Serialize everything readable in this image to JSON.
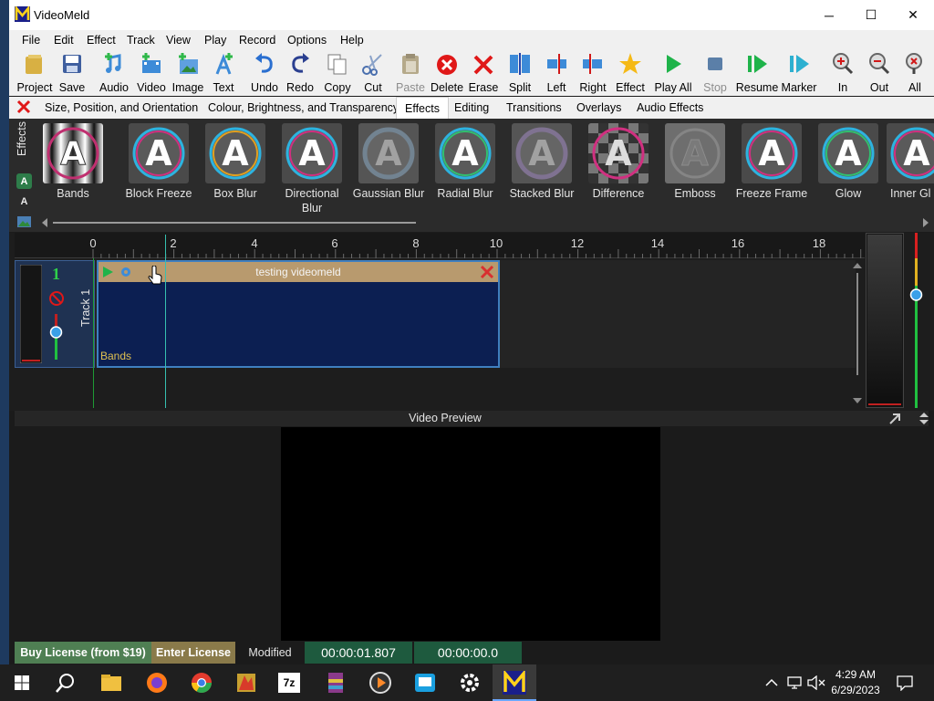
{
  "window": {
    "title": "VideoMeld",
    "minimize_glyph": "─",
    "maximize_glyph": "☐",
    "close_glyph": "✕"
  },
  "menu": [
    "File",
    "Edit",
    "Effect",
    "Track",
    "View",
    "Play",
    "Record",
    "Options",
    "Help"
  ],
  "toolbar": [
    {
      "label": "Project",
      "icon": "folder-icon",
      "enabled": true
    },
    {
      "label": "Save",
      "icon": "save-icon",
      "enabled": true
    },
    {
      "label": "Audio",
      "icon": "add-audio-icon",
      "enabled": true
    },
    {
      "label": "Video",
      "icon": "add-video-icon",
      "enabled": true
    },
    {
      "label": "Image",
      "icon": "add-image-icon",
      "enabled": true
    },
    {
      "label": "Text",
      "icon": "add-text-icon",
      "enabled": true
    },
    {
      "label": "Undo",
      "icon": "undo-icon",
      "enabled": true
    },
    {
      "label": "Redo",
      "icon": "redo-icon",
      "enabled": true
    },
    {
      "label": "Copy",
      "icon": "copy-icon",
      "enabled": true
    },
    {
      "label": "Cut",
      "icon": "scissors-icon",
      "enabled": true
    },
    {
      "label": "Paste",
      "icon": "paste-icon",
      "enabled": false
    },
    {
      "label": "Delete",
      "icon": "delete-icon",
      "enabled": true
    },
    {
      "label": "Erase",
      "icon": "erase-icon",
      "enabled": true
    },
    {
      "label": "Split",
      "icon": "split-icon",
      "enabled": true
    },
    {
      "label": "Left",
      "icon": "trim-left-icon",
      "enabled": true
    },
    {
      "label": "Right",
      "icon": "trim-right-icon",
      "enabled": true
    },
    {
      "label": "Effect",
      "icon": "star-icon",
      "enabled": true
    },
    {
      "label": "Play All",
      "icon": "play-icon",
      "enabled": true
    },
    {
      "label": "Stop",
      "icon": "stop-icon",
      "enabled": false
    },
    {
      "label": "Resume",
      "icon": "resume-icon",
      "enabled": true
    },
    {
      "label": "Marker",
      "icon": "marker-icon",
      "enabled": true
    },
    {
      "label": "In",
      "icon": "zoom-in-icon",
      "enabled": true
    },
    {
      "label": "Out",
      "icon": "zoom-out-icon",
      "enabled": true
    },
    {
      "label": "All",
      "icon": "zoom-all-icon",
      "enabled": true
    }
  ],
  "tabs": [
    {
      "label": "Size, Position, and Orientation",
      "active": false
    },
    {
      "label": "Colour, Brightness, and Transparency",
      "active": false
    },
    {
      "label": "Effects",
      "active": true
    },
    {
      "label": "Editing",
      "active": false
    },
    {
      "label": "Transitions",
      "active": false
    },
    {
      "label": "Overlays",
      "active": false
    },
    {
      "label": "Audio Effects",
      "active": false
    }
  ],
  "effects_panel": {
    "side_label": "Effects",
    "side_letter_a": "A",
    "side_letter_a2": "A",
    "items": [
      {
        "name": "Bands",
        "style": "bands"
      },
      {
        "name": "Block Freeze",
        "style": "ring"
      },
      {
        "name": "Box Blur",
        "style": "ring"
      },
      {
        "name": "Directional Blur",
        "style": "ring"
      },
      {
        "name": "Gaussian Blur",
        "style": "blur"
      },
      {
        "name": "Radial Blur",
        "style": "ring"
      },
      {
        "name": "Stacked Blur",
        "style": "blur"
      },
      {
        "name": "Difference",
        "style": "checker"
      },
      {
        "name": "Emboss",
        "style": "emboss"
      },
      {
        "name": "Freeze Frame",
        "style": "ring"
      },
      {
        "name": "Glow",
        "style": "ring"
      },
      {
        "name": "Inner Gl",
        "style": "ring"
      }
    ]
  },
  "timeline": {
    "ruler_labels": [
      "0",
      "2",
      "4",
      "6",
      "8",
      "10",
      "12",
      "14",
      "16",
      "18"
    ],
    "track": {
      "number": "1",
      "name": "Track 1"
    },
    "clip": {
      "title": "testing videomeld",
      "effect_label": "Bands"
    }
  },
  "preview": {
    "title": "Video Preview"
  },
  "status": {
    "buy_license": "Buy License (from $19)",
    "enter_license": "Enter License",
    "modified": "Modified",
    "position_time": "00:00:01.807",
    "selection_time": "00:00:00.0"
  },
  "taskbar": {
    "time": "4:29 AM",
    "date": "6/29/2023",
    "zip_label": "7z"
  },
  "colors": {
    "clip_body": "#0c1f52",
    "clip_header": "#b89a6e",
    "playhead": "#36c0b0",
    "buy_license_bg": "#4f7f53",
    "enter_license_bg": "#8a7a4a",
    "time_bg": "#1e5a3e"
  }
}
